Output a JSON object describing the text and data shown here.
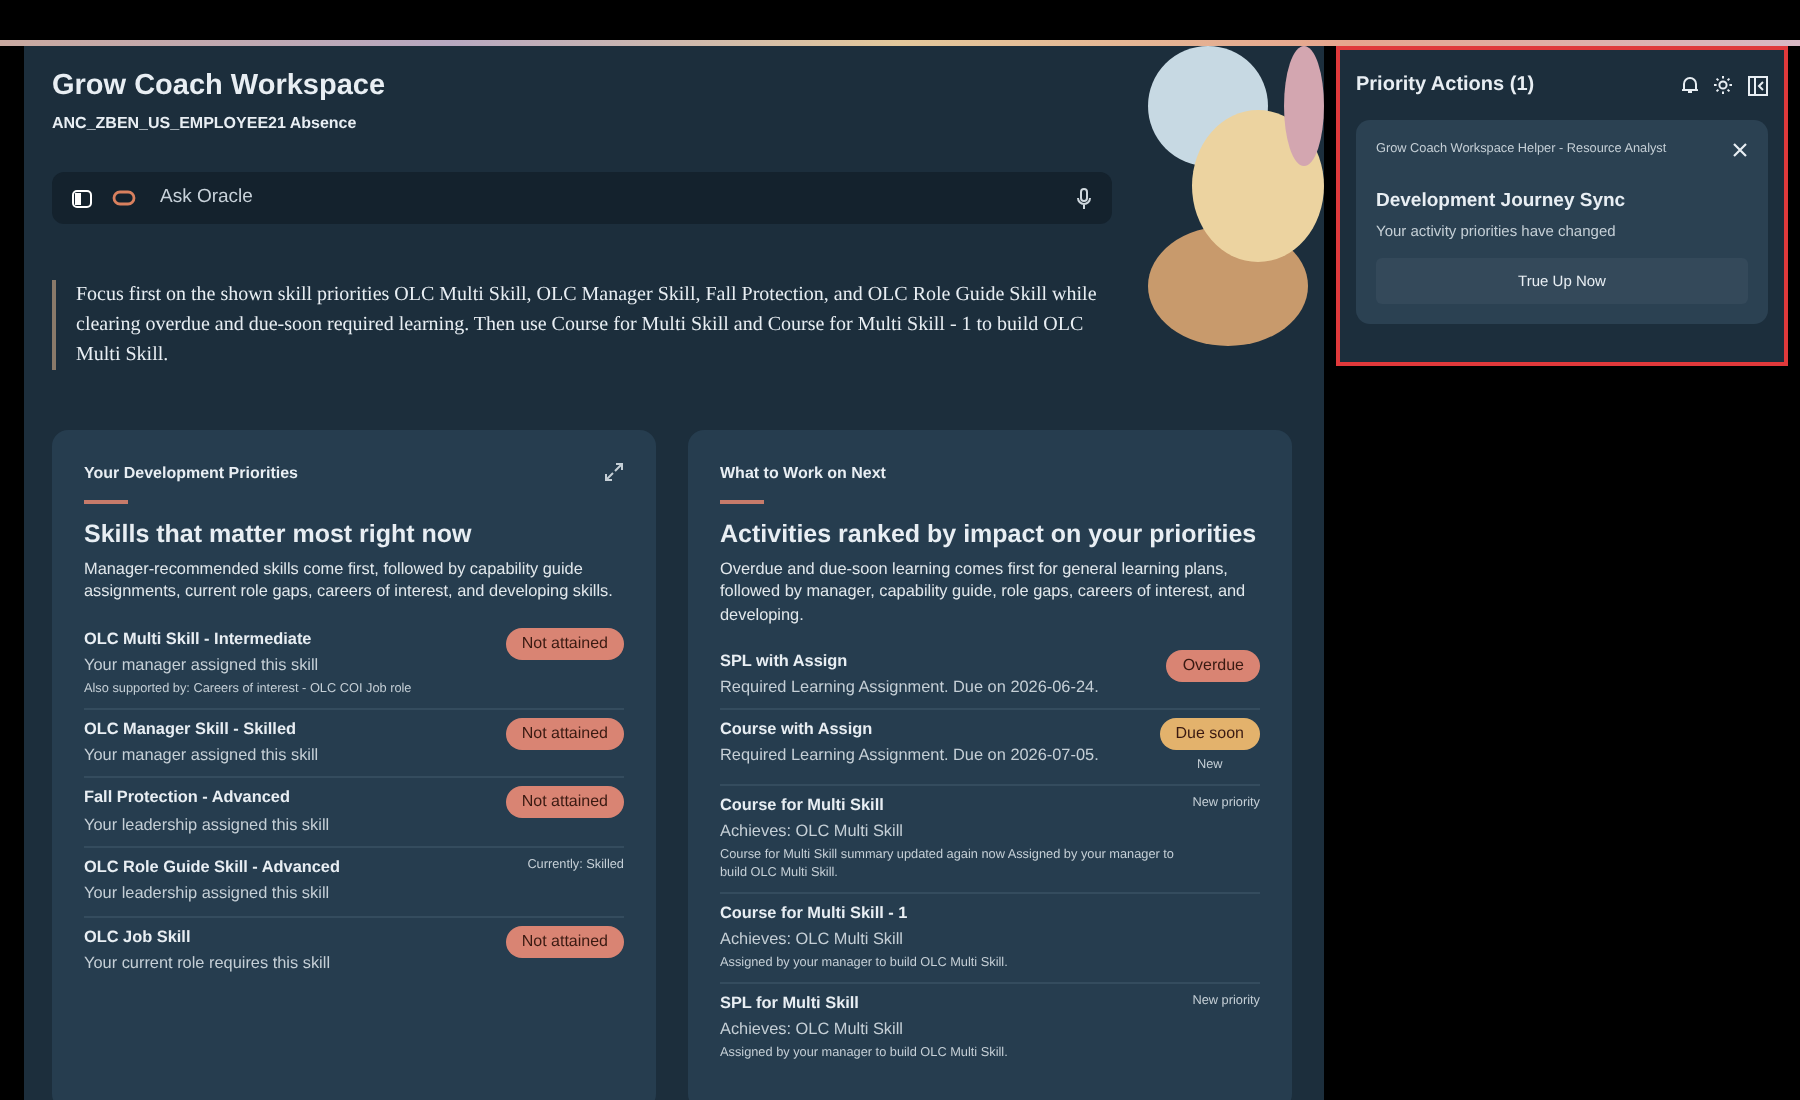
{
  "header": {
    "title": "Grow Coach Workspace",
    "subtitle": "ANC_ZBEN_US_EMPLOYEE21 Absence"
  },
  "ask_bar": {
    "placeholder": "Ask Oracle"
  },
  "focus_text": "Focus first on the shown skill priorities OLC Multi Skill, OLC Manager Skill, Fall Protection, and OLC Role Guide Skill while clearing overdue and due-soon required learning. Then use Course for Multi Skill and Course for Multi Skill - 1 to build OLC Multi Skill.",
  "cards": [
    {
      "eyebrow": "Your Development Priorities",
      "expandable": true,
      "heading": "Skills that matter most right now",
      "description": "Manager-recommended skills come first, followed by capability guide assignments, current role gaps, careers of interest, and developing skills.",
      "items": [
        {
          "title": "OLC Multi Skill - Intermediate",
          "subtitle": "Your manager assigned this skill",
          "note": "Also supported by: Careers of interest - OLC COI Job role",
          "status": {
            "kind": "pill",
            "color": "#d98473",
            "text": "Not attained"
          }
        },
        {
          "title": "OLC Manager Skill - Skilled",
          "subtitle": "Your manager assigned this skill",
          "status": {
            "kind": "pill",
            "color": "#d98473",
            "text": "Not attained"
          }
        },
        {
          "title": "Fall Protection - Advanced",
          "subtitle": "Your leadership assigned this skill",
          "status": {
            "kind": "pill",
            "color": "#d98473",
            "text": "Not attained"
          }
        },
        {
          "title": "OLC Role Guide Skill - Advanced",
          "subtitle": "Your leadership assigned this skill",
          "status": {
            "kind": "tag",
            "text": "Currently: Skilled"
          }
        },
        {
          "title": "OLC Job Skill",
          "subtitle": "Your current role requires this skill",
          "status": {
            "kind": "pill",
            "color": "#d98473",
            "text": "Not attained"
          }
        }
      ]
    },
    {
      "eyebrow": "What to Work on Next",
      "expandable": false,
      "heading": "Activities ranked by impact on your priorities",
      "description": "Overdue and due-soon learning comes first for general learning plans, followed by manager, capability guide, role gaps, careers of interest, and developing.",
      "items": [
        {
          "title": "SPL with Assign",
          "subtitle": "Required Learning Assignment. Due on 2026-06-24.",
          "status": {
            "kind": "pill",
            "color": "#d98473",
            "text": "Overdue"
          }
        },
        {
          "title": "Course with Assign",
          "subtitle": "Required Learning Assignment. Due on 2026-07-05.",
          "status": {
            "kind": "pill",
            "color": "#e3b26c",
            "text": "Due soon",
            "sub": "New"
          }
        },
        {
          "title": "Course for Multi Skill",
          "subtitle": "Achieves: OLC Multi Skill",
          "note": "Course for Multi Skill summary updated again now Assigned by your manager to build OLC Multi Skill.",
          "status": {
            "kind": "tag",
            "text": "New priority"
          }
        },
        {
          "title": "Course for Multi Skill - 1",
          "subtitle": "Achieves: OLC Multi Skill",
          "note": "Assigned by your manager to build OLC Multi Skill."
        },
        {
          "title": "SPL for Multi Skill",
          "subtitle": "Achieves: OLC Multi Skill",
          "note": "Assigned by your manager to build OLC Multi Skill.",
          "status": {
            "kind": "tag",
            "text": "New priority"
          }
        }
      ]
    }
  ],
  "panel": {
    "title": "Priority Actions (1)",
    "highlighted": true,
    "notification": {
      "source": "Grow Coach Workspace Helper - Resource Analyst",
      "title": "Development Journey Sync",
      "message": "Your activity priorities have changed",
      "action": "True Up Now"
    }
  }
}
